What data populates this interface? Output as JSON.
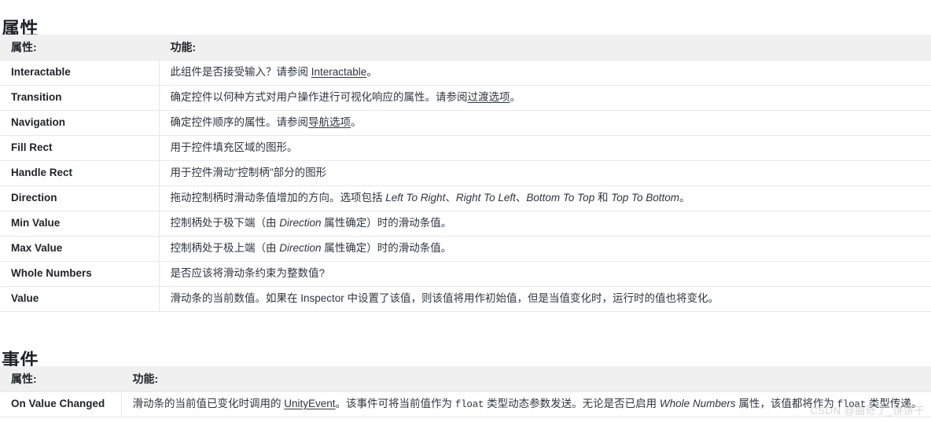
{
  "sections": {
    "properties": {
      "heading": "属性",
      "columns": {
        "property": "属性:",
        "function": "功能:"
      },
      "rows": [
        {
          "property": "Interactable",
          "desc_parts": [
            {
              "t": "此组件是否接受输入？请参阅 ",
              "s": "plain"
            },
            {
              "t": "Interactable",
              "s": "link"
            },
            {
              "t": "。",
              "s": "plain"
            }
          ]
        },
        {
          "property": "Transition",
          "desc_parts": [
            {
              "t": "确定控件以何种方式对用户操作进行可视化响应的属性。请参阅",
              "s": "plain"
            },
            {
              "t": "过渡选项",
              "s": "link"
            },
            {
              "t": "。",
              "s": "plain"
            }
          ]
        },
        {
          "property": "Navigation",
          "desc_parts": [
            {
              "t": "确定控件顺序的属性。请参阅",
              "s": "plain"
            },
            {
              "t": "导航选项",
              "s": "link"
            },
            {
              "t": "。",
              "s": "plain"
            }
          ]
        },
        {
          "property": "Fill Rect",
          "desc_parts": [
            {
              "t": "用于控件填充区域的图形。",
              "s": "plain"
            }
          ]
        },
        {
          "property": "Handle Rect",
          "desc_parts": [
            {
              "t": "用于控件滑动\"控制柄\"部分的图形",
              "s": "plain"
            }
          ]
        },
        {
          "property": "Direction",
          "desc_parts": [
            {
              "t": "拖动控制柄时滑动条值增加的方向。选项包括 ",
              "s": "plain"
            },
            {
              "t": "Left To Right",
              "s": "em"
            },
            {
              "t": "、",
              "s": "plain"
            },
            {
              "t": "Right To Left",
              "s": "em"
            },
            {
              "t": "、",
              "s": "plain"
            },
            {
              "t": "Bottom To Top",
              "s": "em"
            },
            {
              "t": " 和 ",
              "s": "plain"
            },
            {
              "t": "Top To Bottom",
              "s": "em"
            },
            {
              "t": "。",
              "s": "plain"
            }
          ]
        },
        {
          "property": "Min Value",
          "desc_parts": [
            {
              "t": "控制柄处于极下端（由 ",
              "s": "plain"
            },
            {
              "t": "Direction",
              "s": "em"
            },
            {
              "t": " 属性确定）时的滑动条值。",
              "s": "plain"
            }
          ]
        },
        {
          "property": "Max Value",
          "desc_parts": [
            {
              "t": "控制柄处于极上端（由 ",
              "s": "plain"
            },
            {
              "t": "Direction",
              "s": "em"
            },
            {
              "t": " 属性确定）时的滑动条值。",
              "s": "plain"
            }
          ]
        },
        {
          "property": "Whole Numbers",
          "desc_parts": [
            {
              "t": "是否应该将滑动条约束为整数值?",
              "s": "plain"
            }
          ]
        },
        {
          "property": "Value",
          "desc_parts": [
            {
              "t": "滑动条的当前数值。如果在 Inspector 中设置了该值，则该值将用作初始值，但是当值变化时，运行时的值也将变化。",
              "s": "plain"
            }
          ]
        }
      ]
    },
    "events": {
      "heading": "事件",
      "columns": {
        "property": "属性:",
        "function": "功能:"
      },
      "rows": [
        {
          "property": "On Value Changed",
          "desc_parts": [
            {
              "t": "滑动条的当前值已变化时调用的 ",
              "s": "plain"
            },
            {
              "t": "UnityEvent",
              "s": "link"
            },
            {
              "t": "。该事件可将当前值作为 ",
              "s": "plain"
            },
            {
              "t": "float",
              "s": "code"
            },
            {
              "t": " 类型动态参数发送。无论是否已启用 ",
              "s": "plain"
            },
            {
              "t": "Whole Numbers",
              "s": "em"
            },
            {
              "t": " 属性，该值都将作为 ",
              "s": "plain"
            },
            {
              "t": "float",
              "s": "code"
            },
            {
              "t": " 类型传递。",
              "s": "plain"
            }
          ]
        }
      ]
    }
  },
  "watermark": {
    "text": "CSDN @曲奇了_饼饼干"
  },
  "colors": {
    "header_bg": "#f0f0f0",
    "border": "#e8e8e8",
    "text": "#2f3640",
    "heading": "#1f2328"
  }
}
